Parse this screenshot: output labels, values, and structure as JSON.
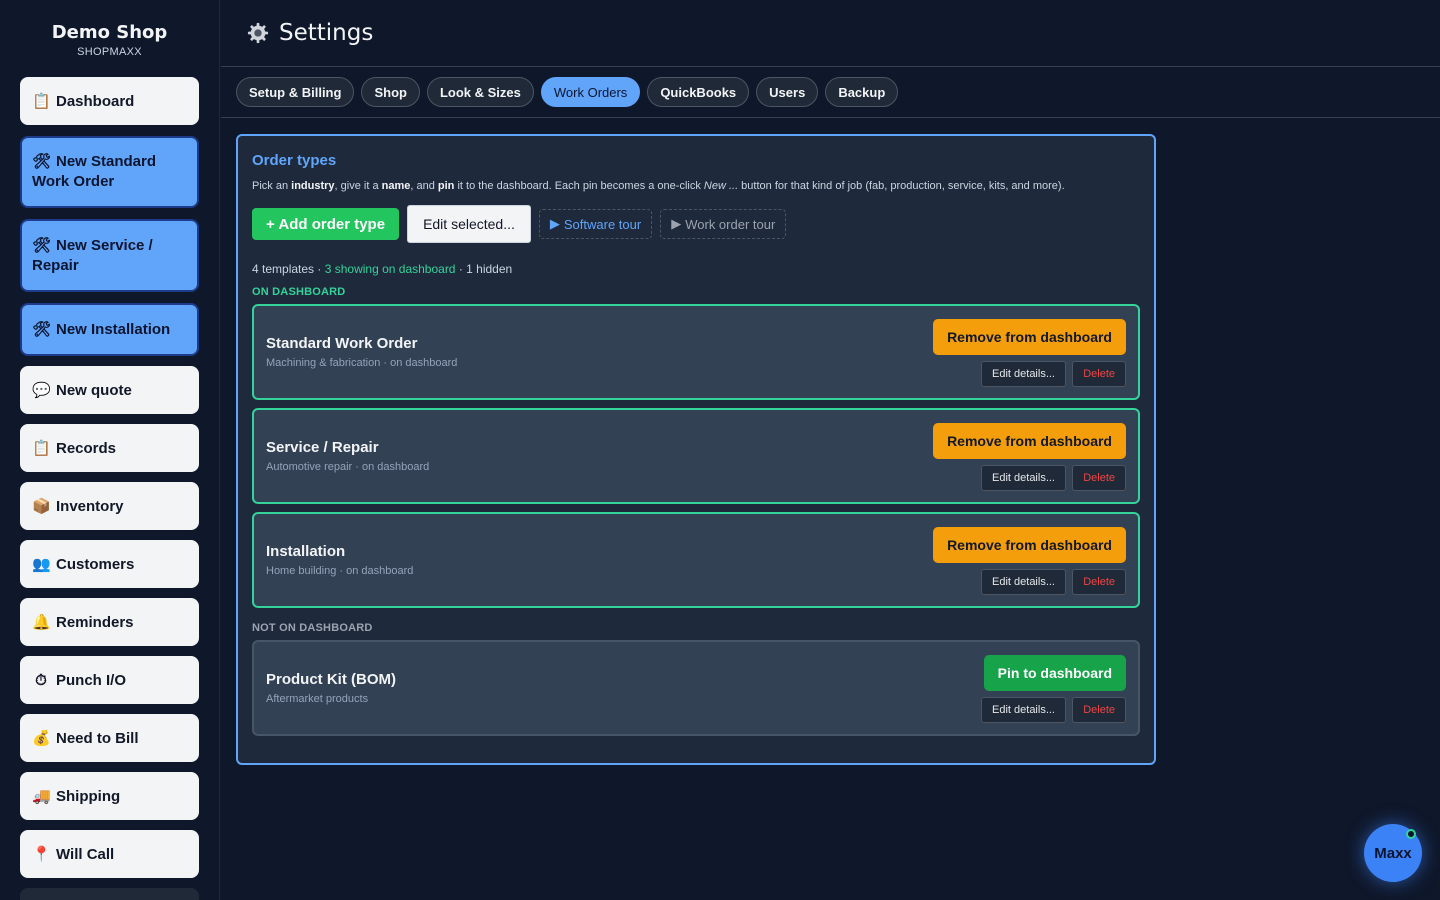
{
  "brand": {
    "name": "Demo Shop",
    "subtitle": "SHOPMAXX"
  },
  "sidebar": {
    "items": [
      {
        "label": "Dashboard",
        "icon": "clipboard-icon",
        "style": "plain"
      },
      {
        "label": "New Standard Work Order",
        "icon": "tools-icon",
        "style": "blue"
      },
      {
        "label": "New Service / Repair",
        "icon": "tools-icon",
        "style": "blue"
      },
      {
        "label": "New Installation",
        "icon": "tools-icon",
        "style": "blue"
      },
      {
        "label": "New quote",
        "icon": "speech-bubble-icon",
        "style": "plain"
      },
      {
        "label": "Records",
        "icon": "clipboard-icon",
        "style": "plain"
      },
      {
        "label": "Inventory",
        "icon": "box-icon",
        "style": "plain"
      },
      {
        "label": "Customers",
        "icon": "people-icon",
        "style": "plain"
      },
      {
        "label": "Reminders",
        "icon": "bell-icon",
        "style": "plain"
      },
      {
        "label": "Punch I/O",
        "icon": "stopwatch-icon",
        "style": "plain"
      },
      {
        "label": "Need to Bill",
        "icon": "money-bag-icon",
        "style": "plain"
      },
      {
        "label": "Shipping",
        "icon": "truck-icon",
        "style": "plain"
      },
      {
        "label": "Will Call",
        "icon": "pin-icon",
        "style": "plain"
      }
    ]
  },
  "header": {
    "title": "Settings",
    "icon": "gear-icon"
  },
  "tabs": [
    {
      "label": "Setup & Billing",
      "active": false
    },
    {
      "label": "Shop",
      "active": false
    },
    {
      "label": "Look & Sizes",
      "active": false
    },
    {
      "label": "Work Orders",
      "active": true
    },
    {
      "label": "QuickBooks",
      "active": false
    },
    {
      "label": "Users",
      "active": false
    },
    {
      "label": "Backup",
      "active": false
    }
  ],
  "panel": {
    "title": "Order types",
    "desc": {
      "p1": "Pick an ",
      "b1": "industry",
      "p2": ", give it a ",
      "b2": "name",
      "p3": ", and ",
      "b3": "pin",
      "p4": " it to the dashboard. Each pin becomes a one-click ",
      "i1": "New ...",
      "p5": " button for that kind of job (fab, production, service, kits, and more)."
    },
    "add_label": "+ Add order type",
    "edit_selected_label": "Edit selected...",
    "software_tour_label": "Software tour",
    "work_order_tour_label": "Work order tour",
    "summary": {
      "count": "4",
      "templates_text": " templates · ",
      "showing": "3 showing on dashboard",
      "hidden": " · 1 hidden"
    },
    "on_label": "ON DASHBOARD",
    "off_label": "NOT ON DASHBOARD",
    "edit_details_label": "Edit details...",
    "delete_label": "Delete",
    "remove_label": "Remove from dashboard",
    "pin_label": "Pin to dashboard",
    "on_dashboard": [
      {
        "name": "Standard Work Order",
        "sub": "Machining & fabrication · on dashboard"
      },
      {
        "name": "Service / Repair",
        "sub": "Automotive repair · on dashboard"
      },
      {
        "name": "Installation",
        "sub": "Home building · on dashboard"
      }
    ],
    "not_on_dashboard": [
      {
        "name": "Product Kit (BOM)",
        "sub": "Aftermarket products"
      }
    ]
  },
  "assistant": {
    "label": "Maxx"
  },
  "colors": {
    "accent": "#60a5fa",
    "green": "#34d399",
    "orange": "#f59e0b",
    "danger": "#ef4444"
  }
}
